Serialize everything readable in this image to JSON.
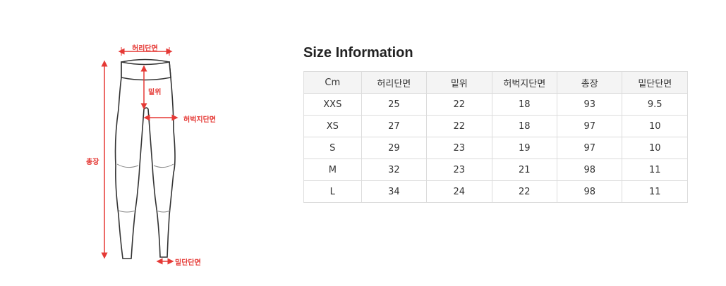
{
  "diagram": {
    "labels": {
      "waist": "허리단면",
      "rise": "밑위",
      "thigh": "허벅지단면",
      "length": "총장",
      "hem": "밑단단면"
    },
    "accent_color": "#e53935"
  },
  "size_info": {
    "title": "Size Information",
    "headers": [
      "Cm",
      "허리단면",
      "밑위",
      "허벅지단면",
      "총장",
      "밑단단면"
    ],
    "rows": [
      [
        "XXS",
        "25",
        "22",
        "18",
        "93",
        "9.5"
      ],
      [
        "XS",
        "27",
        "22",
        "18",
        "97",
        "10"
      ],
      [
        "S",
        "29",
        "23",
        "19",
        "97",
        "10"
      ],
      [
        "M",
        "32",
        "23",
        "21",
        "98",
        "11"
      ],
      [
        "L",
        "34",
        "24",
        "22",
        "98",
        "11"
      ]
    ]
  }
}
